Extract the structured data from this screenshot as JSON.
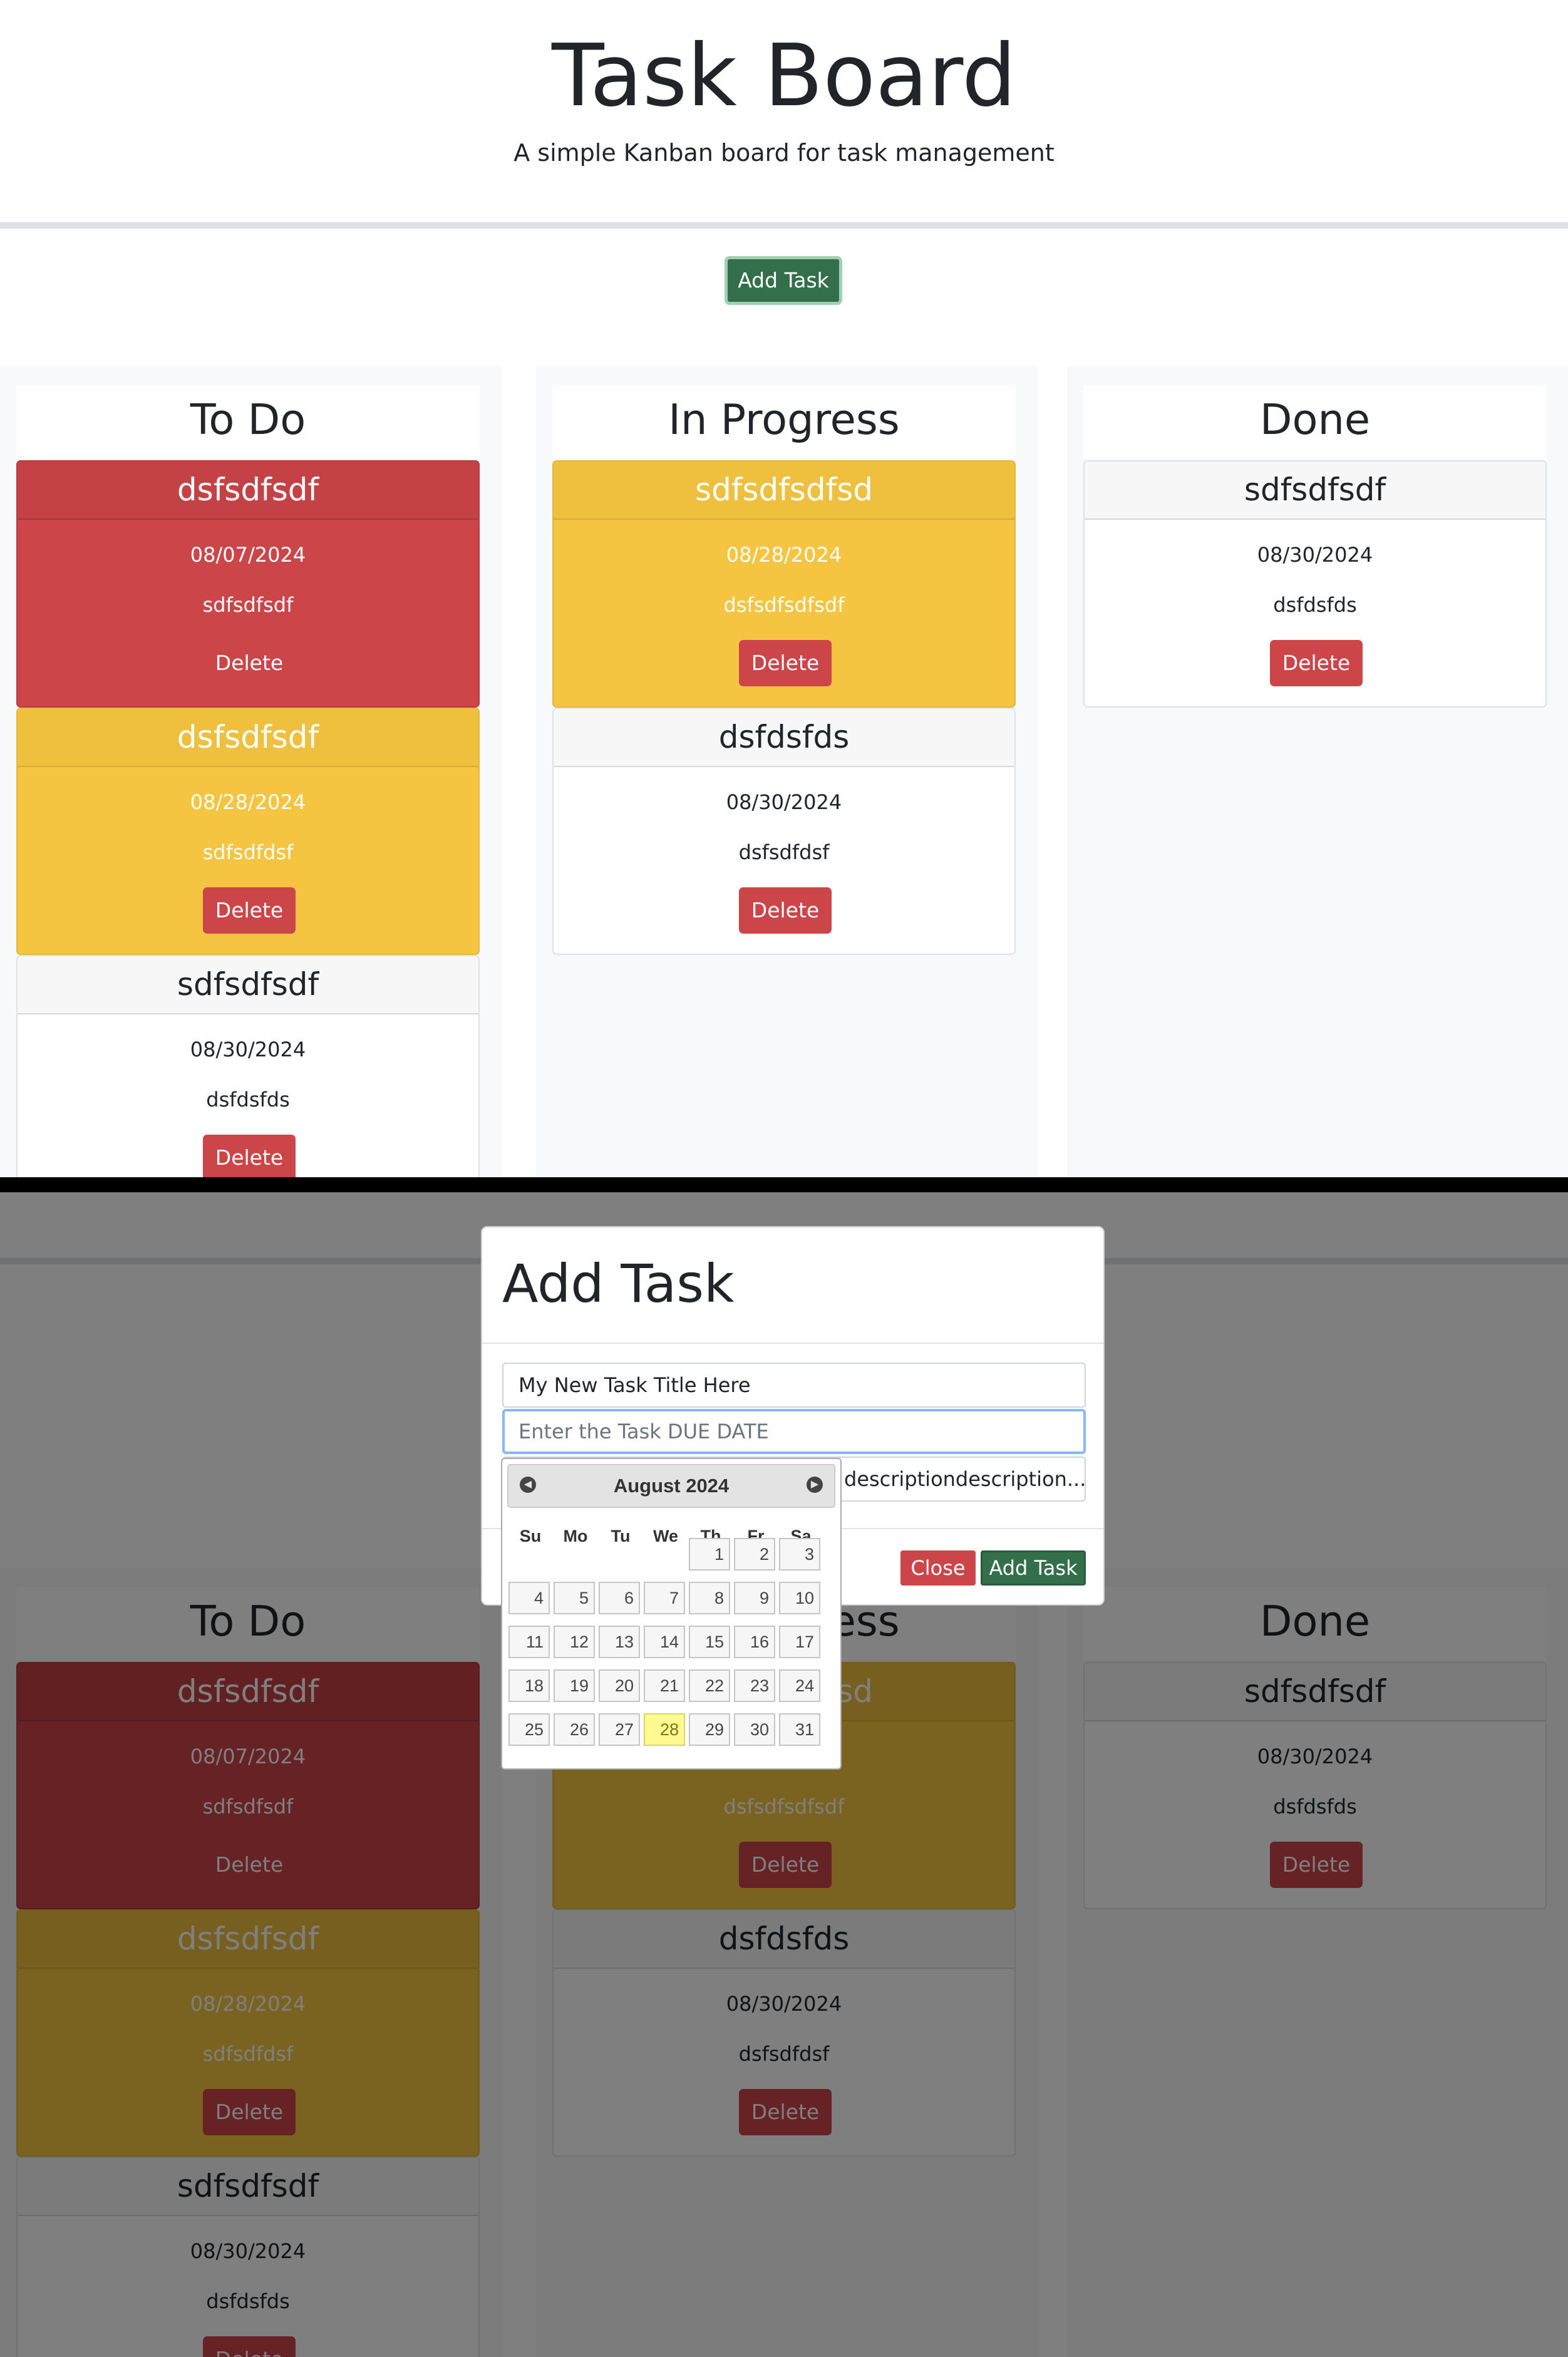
{
  "header": {
    "title": "Task Board",
    "subtitle": "A simple Kanban board for task management"
  },
  "add_task_button": "Add Task",
  "lanes": [
    {
      "title": "To Do"
    },
    {
      "title": "In Progress"
    },
    {
      "title": "Done"
    }
  ],
  "cards": {
    "todo": [
      {
        "title": "dsfsdfsdf",
        "date": "08/07/2024",
        "description": "sdfsdfsdf",
        "delete": "Delete",
        "status": "overdue"
      },
      {
        "title": "dsfsdfsdf",
        "date": "08/28/2024",
        "description": "sdfsdfdsf",
        "delete": "Delete",
        "status": "due-soon"
      },
      {
        "title": "sdfsdfsdf",
        "date": "08/30/2024",
        "description": "dsfdsfds",
        "delete": "Delete",
        "status": "normal"
      }
    ],
    "inprogress": [
      {
        "title": "sdfsdfsdfsd",
        "date": "08/28/2024",
        "description": "dsfsdfsdfsdf",
        "delete": "Delete",
        "status": "due-soon"
      },
      {
        "title": "dsfdsfds",
        "date": "08/30/2024",
        "description": "dsfsdfdsf",
        "delete": "Delete",
        "status": "normal"
      }
    ],
    "done": [
      {
        "title": "sdfsdfsdf",
        "date": "08/30/2024",
        "description": "dsfdsfds",
        "delete": "Delete",
        "status": "normal"
      }
    ]
  },
  "modal": {
    "title": "Add Task",
    "title_value": "My New Task Title Here",
    "date_placeholder": "Enter the Task DUE DATE",
    "description_value": "descriptiondescription...",
    "close_label": "Close",
    "submit_label": "Add Task"
  },
  "datepicker": {
    "month": "August 2024",
    "prev_icon": "circle-triangle-w-icon",
    "next_icon": "circle-triangle-e-icon",
    "weekdays": [
      "Su",
      "Mo",
      "Tu",
      "We",
      "Th",
      "Fr",
      "Sa"
    ],
    "first_weekday_index": 4,
    "days_in_month": 31,
    "highlighted_day": 28
  },
  "colors": {
    "danger": "#cc4549",
    "warning": "#f5c542",
    "success": "#346f4c",
    "lane_bg": "#f8f9fa"
  }
}
